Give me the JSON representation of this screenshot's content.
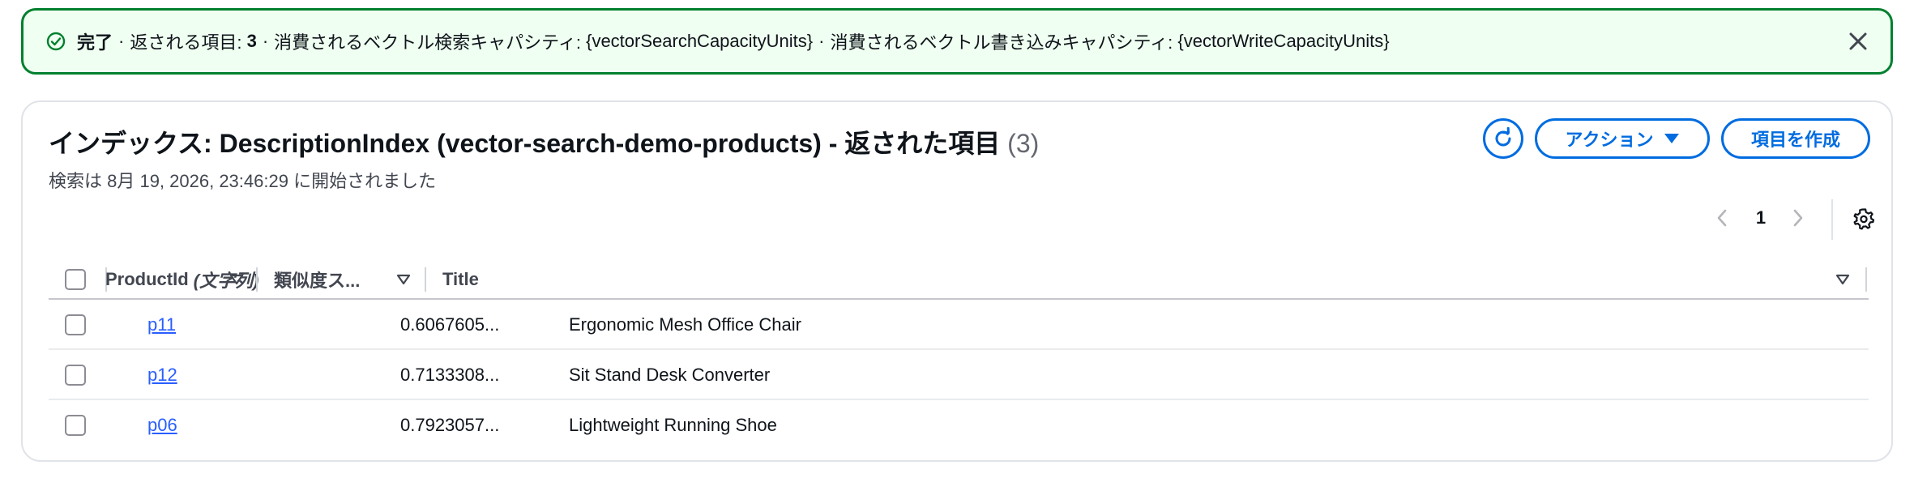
{
  "flash": {
    "status_label": "完了",
    "sep": "·",
    "items_label": "返される項目:",
    "items_count": "3",
    "read_label": "消費されるベクトル検索キャパシティ:",
    "read_value": "{vectorSearchCapacityUnits}",
    "write_label": "消費されるベクトル書き込みキャパシティ:",
    "write_value": "{vectorWriteCapacityUnits}",
    "color": "#00802f"
  },
  "header": {
    "title": "インデックス: DescriptionIndex (vector-search-demo-products) - 返された項目",
    "count": "(3)",
    "description": "検索は 8月 19, 2026, 23:46:29 に開始されました"
  },
  "actions": {
    "actions_label": "アクション",
    "create_label": "項目を作成",
    "accent": "#006ce0"
  },
  "pagination": {
    "current_page": "1"
  },
  "table": {
    "columns": [
      {
        "label": "ProductId",
        "type": "(文字列)"
      },
      {
        "label": "類似度ス..."
      },
      {
        "label": "Title"
      }
    ],
    "rows": [
      {
        "id": "p11",
        "score": "0.6067605...",
        "title": "Ergonomic Mesh Office Chair"
      },
      {
        "id": "p12",
        "score": "0.7133308...",
        "title": "Sit Stand Desk Converter"
      },
      {
        "id": "p06",
        "score": "0.7923057...",
        "title": "Lightweight Running Shoe"
      }
    ],
    "link_color": "#295eff"
  }
}
